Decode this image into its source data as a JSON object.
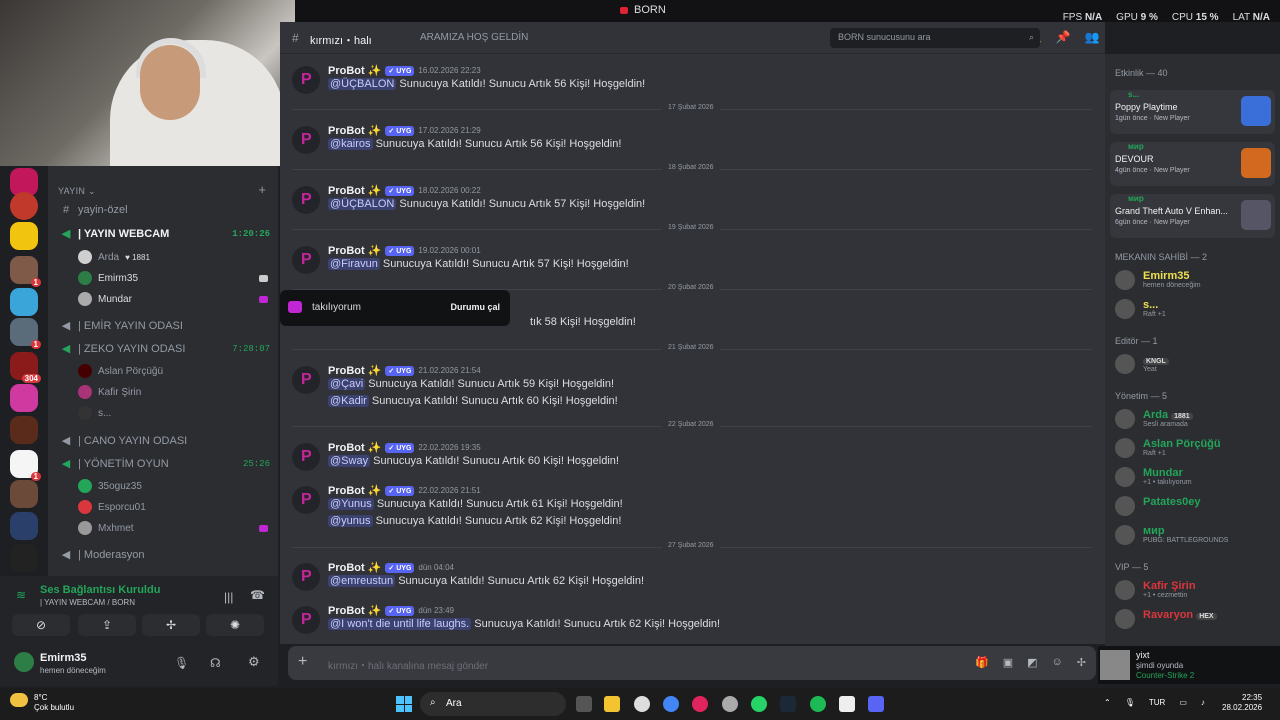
{
  "topbar": {
    "title": "BORN",
    "fps_label": "FPS",
    "fps_val": "N/A",
    "gpu_label": "GPU",
    "gpu_val": "9 %",
    "cpu_label": "CPU",
    "cpu_val": "15 %",
    "lat_label": "LAT",
    "lat_val": "N/A"
  },
  "channels": {
    "category": "YAYIN",
    "text_channel": "yayin-özel",
    "items": [
      {
        "label": "| YAYIN WEBCAM",
        "timer": "1:20:26"
      },
      {
        "label": "| EMİR YAYIN ODASI",
        "timer": ""
      },
      {
        "label": "| ZEKO YAYIN ODASI",
        "timer": "7:28:07"
      },
      {
        "label": "| CANO YAYIN ODASI",
        "timer": ""
      },
      {
        "label": "| YÖNETİM OYUN",
        "timer": "25:26"
      },
      {
        "label": "| Moderasyon",
        "timer": ""
      }
    ],
    "webcam_users": [
      "Arda",
      "Emirm35",
      "Mundar"
    ],
    "arda_badge": "1881",
    "zeko_users": [
      "Aslan Pörçüğü",
      "Kafir Şirin",
      "s..."
    ],
    "yonetim_users": [
      "35oguz35",
      "Esporcu01",
      "Mxhmet"
    ]
  },
  "voice": {
    "title": "Ses Bağlantısı Kuruldu",
    "sub": "| YAYIN WEBCAM / BORN",
    "user": "Emirm35",
    "status": "hemen döneceğim"
  },
  "chat": {
    "channel": "kırmızı・halı",
    "topic": "ARAMIZA HOŞ GELDİN",
    "search": "BORN sunucusunu ara",
    "bot": "ProBot ✨",
    "tag": "✓ UYG",
    "dates": [
      "17 Şubat 2026",
      "18 Şubat 2026",
      "19 Şubat 2026",
      "20 Şubat 2026",
      "21 Şubat 2026",
      "22 Şubat 2026",
      "27 Şubat 2026"
    ],
    "messages": [
      {
        "time": "16.02.2026 22:23",
        "lines": [
          {
            "m": "@ÜÇBALON",
            "t": "Sunucuya Katıldı! Sunucu Artık 56 Kişi! Hoşgeldin!"
          }
        ]
      },
      {
        "time": "17.02.2026 21:29",
        "lines": [
          {
            "m": "@kairos",
            "t": "Sunucuya Katıldı! Sunucu Artık 56 Kişi! Hoşgeldin!"
          }
        ]
      },
      {
        "time": "18.02.2026 00:22",
        "lines": [
          {
            "m": "@ÜÇBALON",
            "t": "Sunucuya Katıldı! Sunucu Artık 57 Kişi! Hoşgeldin!"
          }
        ]
      },
      {
        "time": "19.02.2026 00:01",
        "lines": [
          {
            "m": "@Firavun",
            "t": "Sunucuya Katıldı! Sunucu Artık 57 Kişi! Hoşgeldin!"
          }
        ]
      },
      {
        "time": "",
        "lines": [
          {
            "m": "",
            "t": "tık 58 Kişi! Hoşgeldin!"
          }
        ]
      },
      {
        "time": "21.02.2026 21:54",
        "lines": [
          {
            "m": "@Çavi",
            "t": "Sunucuya Katıldı! Sunucu Artık 59 Kişi! Hoşgeldin!"
          },
          {
            "m": "@Kadir",
            "t": "Sunucuya Katıldı! Sunucu Artık 60 Kişi! Hoşgeldin!"
          }
        ]
      },
      {
        "time": "22.02.2026 19:35",
        "lines": [
          {
            "m": "@Sway",
            "t": "Sunucuya Katıldı! Sunucu Artık 60 Kişi! Hoşgeldin!"
          }
        ]
      },
      {
        "time": "22.02.2026 21:51",
        "lines": [
          {
            "m": "@Yunus",
            "t": "Sunucuya Katıldı! Sunucu Artık 61 Kişi! Hoşgeldin!"
          },
          {
            "m": "@yunus",
            "t": "Sunucuya Katıldı! Sunucu Artık 62 Kişi! Hoşgeldin!"
          }
        ]
      },
      {
        "time": "dün 04:04",
        "lines": [
          {
            "m": "@emreustun",
            "t": "Sunucuya Katıldı! Sunucu Artık 62 Kişi! Hoşgeldin!"
          }
        ]
      },
      {
        "time": "dün 23:49",
        "lines": [
          {
            "m": "@I won't die until life laughs.",
            "t": "Sunucuya Katıldı! Sunucu Artık 62 Kişi! Hoşgeldin!"
          }
        ]
      }
    ],
    "popup_text": "takılıyorum",
    "popup_btn": "Durumu çal",
    "composer": "kırmızı・halı kanalına mesaj gönder"
  },
  "members": {
    "activity_header": "Etkinlik — 40",
    "activities": [
      {
        "who": "s...",
        "game": "Poppy Playtime",
        "ago": "1gün önce",
        "tag": "New Player"
      },
      {
        "who": "мир",
        "game": "DEVOUR",
        "ago": "4gün önce",
        "tag": "New Player"
      },
      {
        "who": "мир",
        "game": "Grand Theft Auto V Enhan...",
        "ago": "6gün önce",
        "tag": "New Player"
      }
    ],
    "sections": [
      {
        "title": "MEKANIN SAHİBİ — 2",
        "users": [
          {
            "n": "Emirm35",
            "s": "hemen döneceğim",
            "c": "#f0e050"
          },
          {
            "n": "s...",
            "s": "Raft +1",
            "c": "#f0e050"
          }
        ]
      },
      {
        "title": "Editör — 1",
        "users": [
          {
            "n": "",
            "s": "Yeat",
            "c": "#a0f",
            "badge": "KNGL"
          }
        ]
      },
      {
        "title": "Yönetim — 5",
        "users": [
          {
            "n": "Arda",
            "s": "Sesli aramada",
            "c": "#23a55a",
            "badge": "1881"
          },
          {
            "n": "Aslan Pörçüğü",
            "s": "Raft +1",
            "c": "#23a55a"
          },
          {
            "n": "Mundar",
            "s": "+1 • takılıyorum",
            "c": "#23a55a"
          },
          {
            "n": "Patates0ey",
            "s": "",
            "c": "#23a55a"
          },
          {
            "n": "мир",
            "s": "PUBG: BATTLEGROUNDS",
            "c": "#23a55a"
          }
        ]
      },
      {
        "title": "VIP — 5",
        "users": [
          {
            "n": "Kafir Şirin",
            "s": "+1 • cezmettin",
            "c": "#da373c"
          },
          {
            "n": "Ravaryon",
            "s": "",
            "c": "#da373c",
            "badge": "HEX"
          }
        ]
      }
    ],
    "nowplaying": {
      "user": "yixt",
      "line2": "şimdi oyunda",
      "game": "Counter-Strike 2"
    }
  },
  "taskbar": {
    "temp": "8°C",
    "weather": "Çok bulutlu",
    "search": "Ara",
    "lang": "TUR",
    "time": "22:35",
    "date": "28.02.2026"
  }
}
